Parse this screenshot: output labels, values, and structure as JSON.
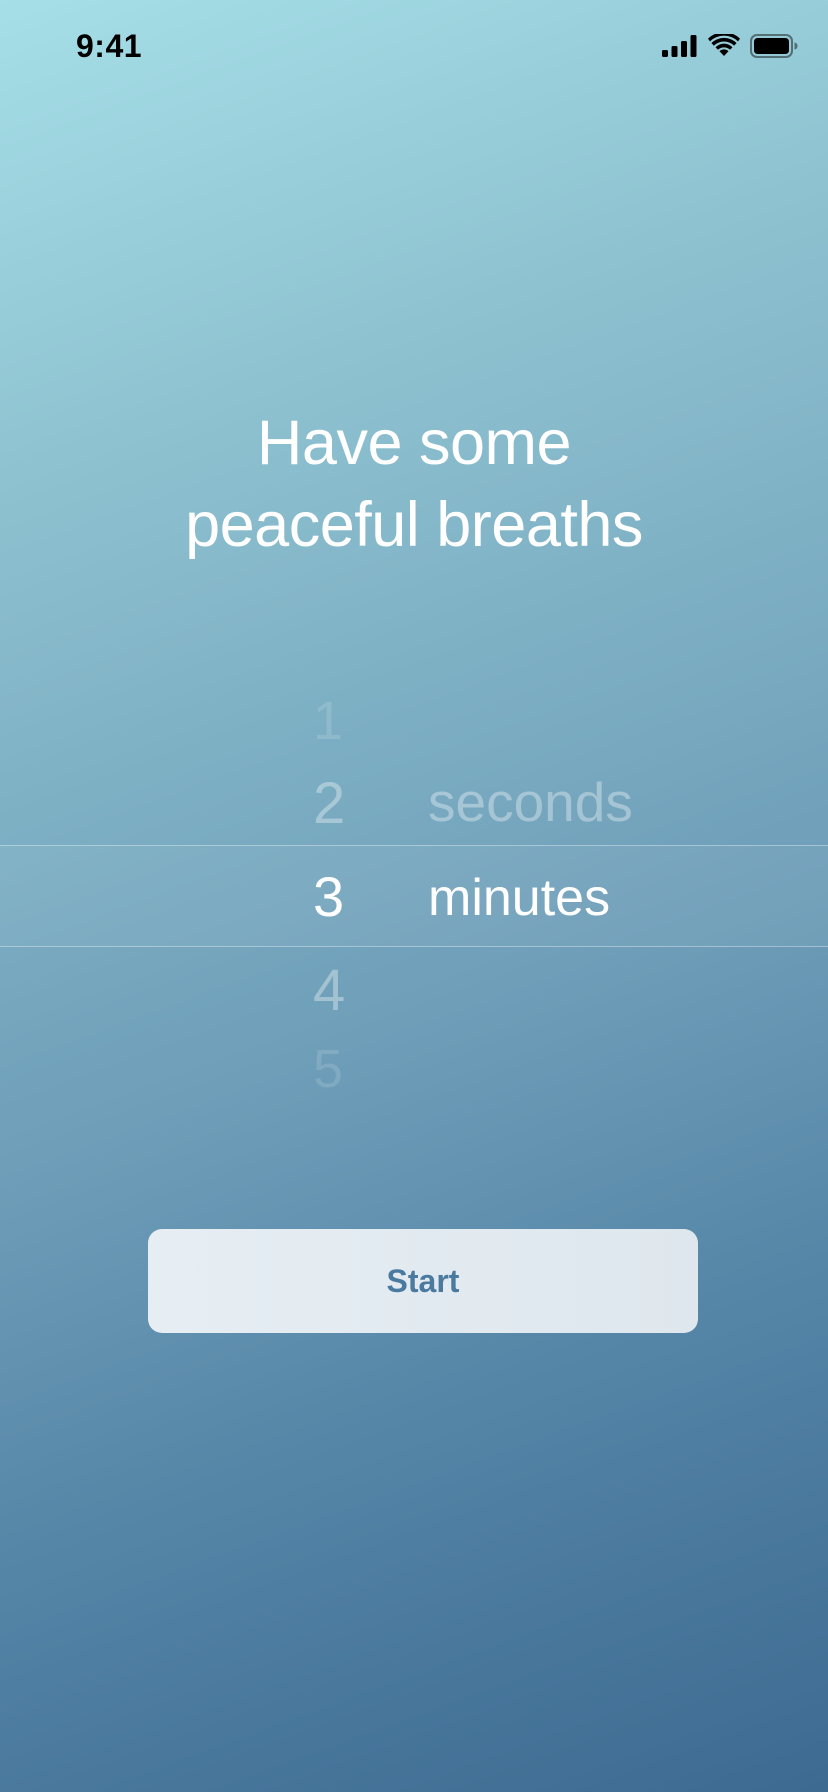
{
  "status_bar": {
    "time": "9:41",
    "icons": [
      "signal-icon",
      "wifi-icon",
      "battery-icon"
    ]
  },
  "title": {
    "line1": "Have some",
    "line2": "peaceful breaths"
  },
  "picker": {
    "numbers": [
      "1",
      "2",
      "3",
      "4",
      "5"
    ],
    "selected_number": "3",
    "units": [
      "seconds",
      "minutes"
    ],
    "selected_unit": "minutes"
  },
  "start_button": {
    "label": "Start"
  },
  "colors": {
    "gradient_top": "#a6dfe8",
    "gradient_bottom": "#3d6a91",
    "button_text": "#4a7aa0",
    "button_bg": "#e4ecf2"
  }
}
